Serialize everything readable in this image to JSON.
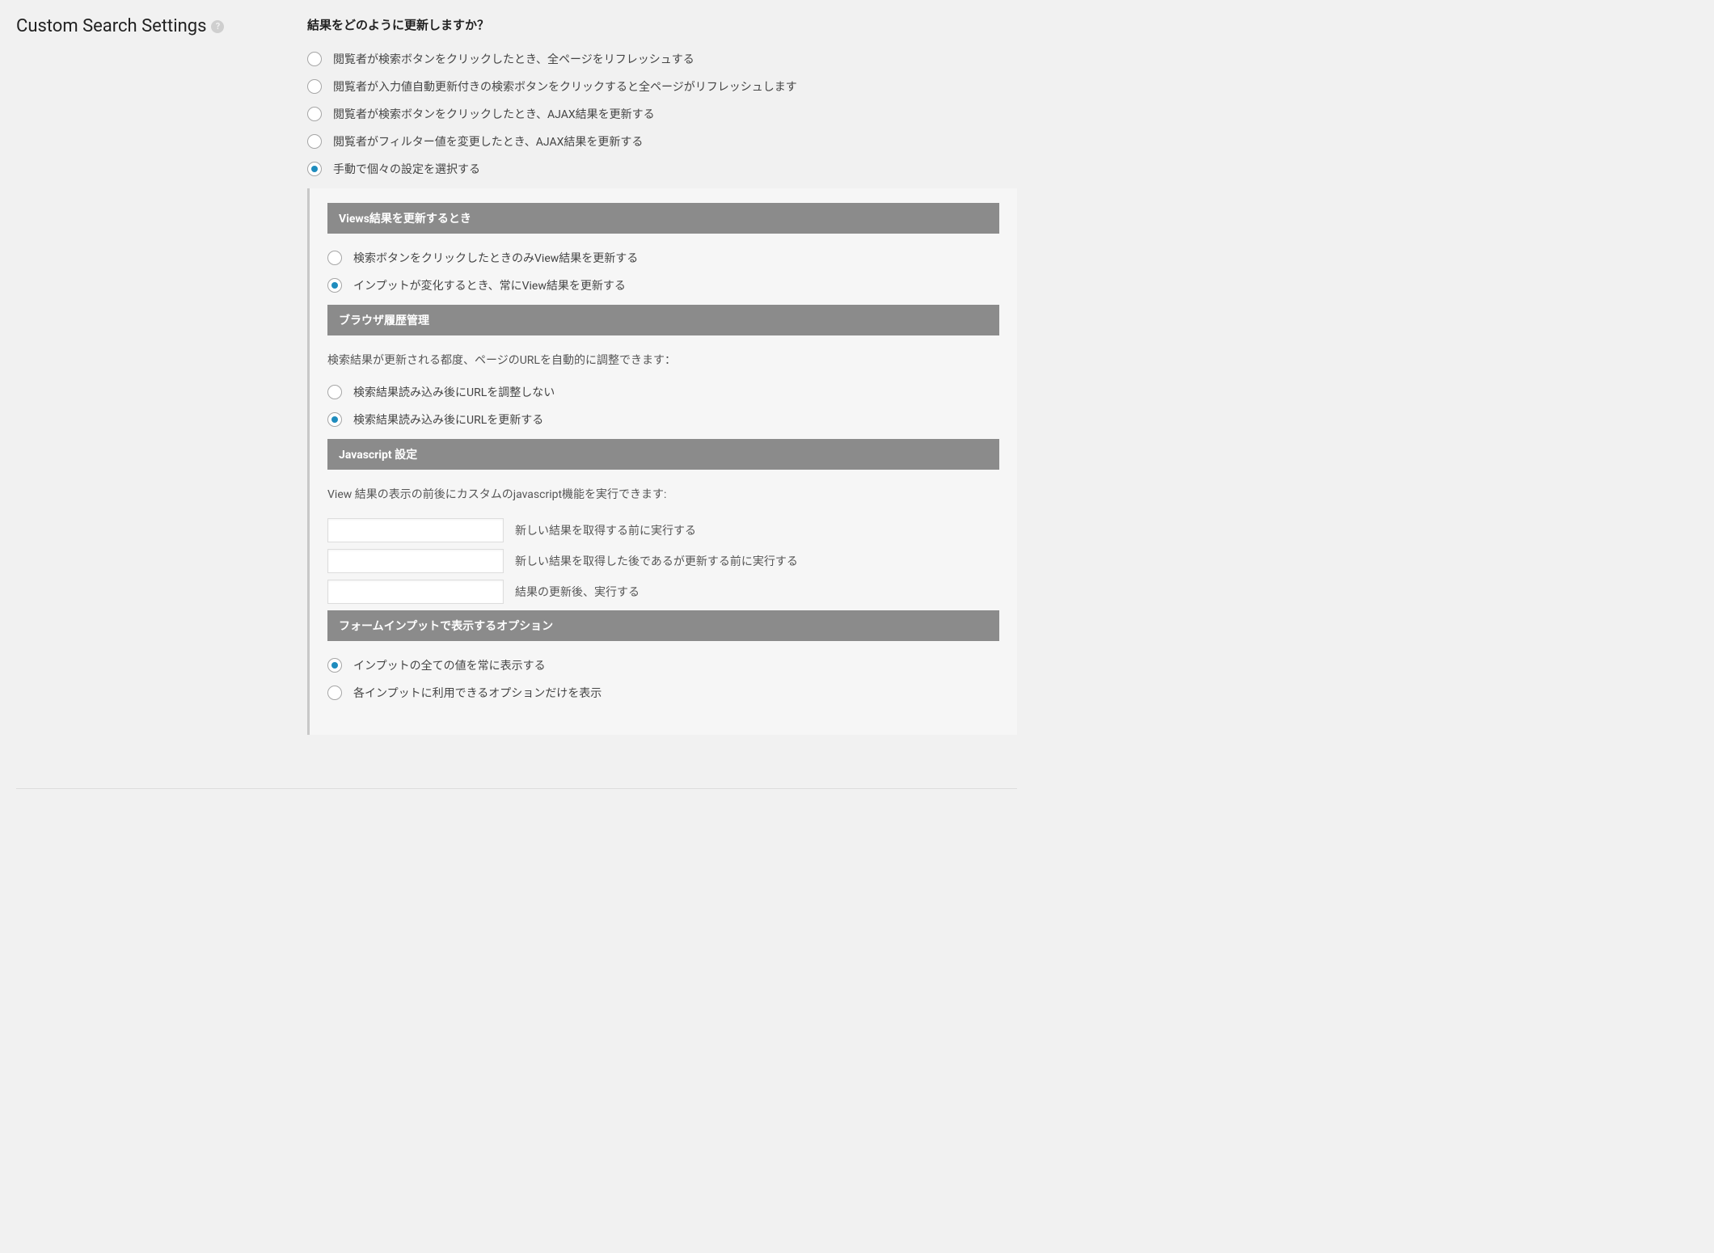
{
  "left": {
    "title": "Custom Search Settings"
  },
  "question": "結果をどのように更新しますか？",
  "updateOptions": [
    {
      "label": "閲覧者が検索ボタンをクリックしたとき、全ページをリフレッシュする",
      "checked": false
    },
    {
      "label": "閲覧者が入力値自動更新付きの検索ボタンをクリックすると全ページがリフレッシュします",
      "checked": false
    },
    {
      "label": "閲覧者が検索ボタンをクリックしたとき、AJAX結果を更新する",
      "checked": false
    },
    {
      "label": "閲覧者がフィルター値を変更したとき、AJAX結果を更新する",
      "checked": false
    },
    {
      "label": "手動で個々の設定を選択する",
      "checked": true
    }
  ],
  "sections": {
    "viewsUpdate": {
      "header": "Views結果を更新するとき",
      "options": [
        {
          "label": "検索ボタンをクリックしたときのみView結果を更新する",
          "checked": false
        },
        {
          "label": "インプットが変化するとき、常にView結果を更新する",
          "checked": true
        }
      ]
    },
    "browserHistory": {
      "header": "ブラウザ履歴管理",
      "desc": "検索結果が更新される都度、ページのURLを自動的に調整できます：",
      "options": [
        {
          "label": "検索結果読み込み後にURLを調整しない",
          "checked": false
        },
        {
          "label": "検索結果読み込み後にURLを更新する",
          "checked": true
        }
      ]
    },
    "javascript": {
      "header": "Javascript 設定",
      "desc": "View 結果の表示の前後にカスタムのjavascript機能を実行できます:",
      "inputs": [
        {
          "value": "",
          "label": "新しい結果を取得する前に実行する"
        },
        {
          "value": "",
          "label": "新しい結果を取得した後であるが更新する前に実行する"
        },
        {
          "value": "",
          "label": "結果の更新後、実行する"
        }
      ]
    },
    "formOptions": {
      "header": "フォームインプットで表示するオプション",
      "options": [
        {
          "label": "インプットの全ての値を常に表示する",
          "checked": true
        },
        {
          "label": "各インプットに利用できるオプションだけを表示",
          "checked": false
        }
      ]
    }
  }
}
